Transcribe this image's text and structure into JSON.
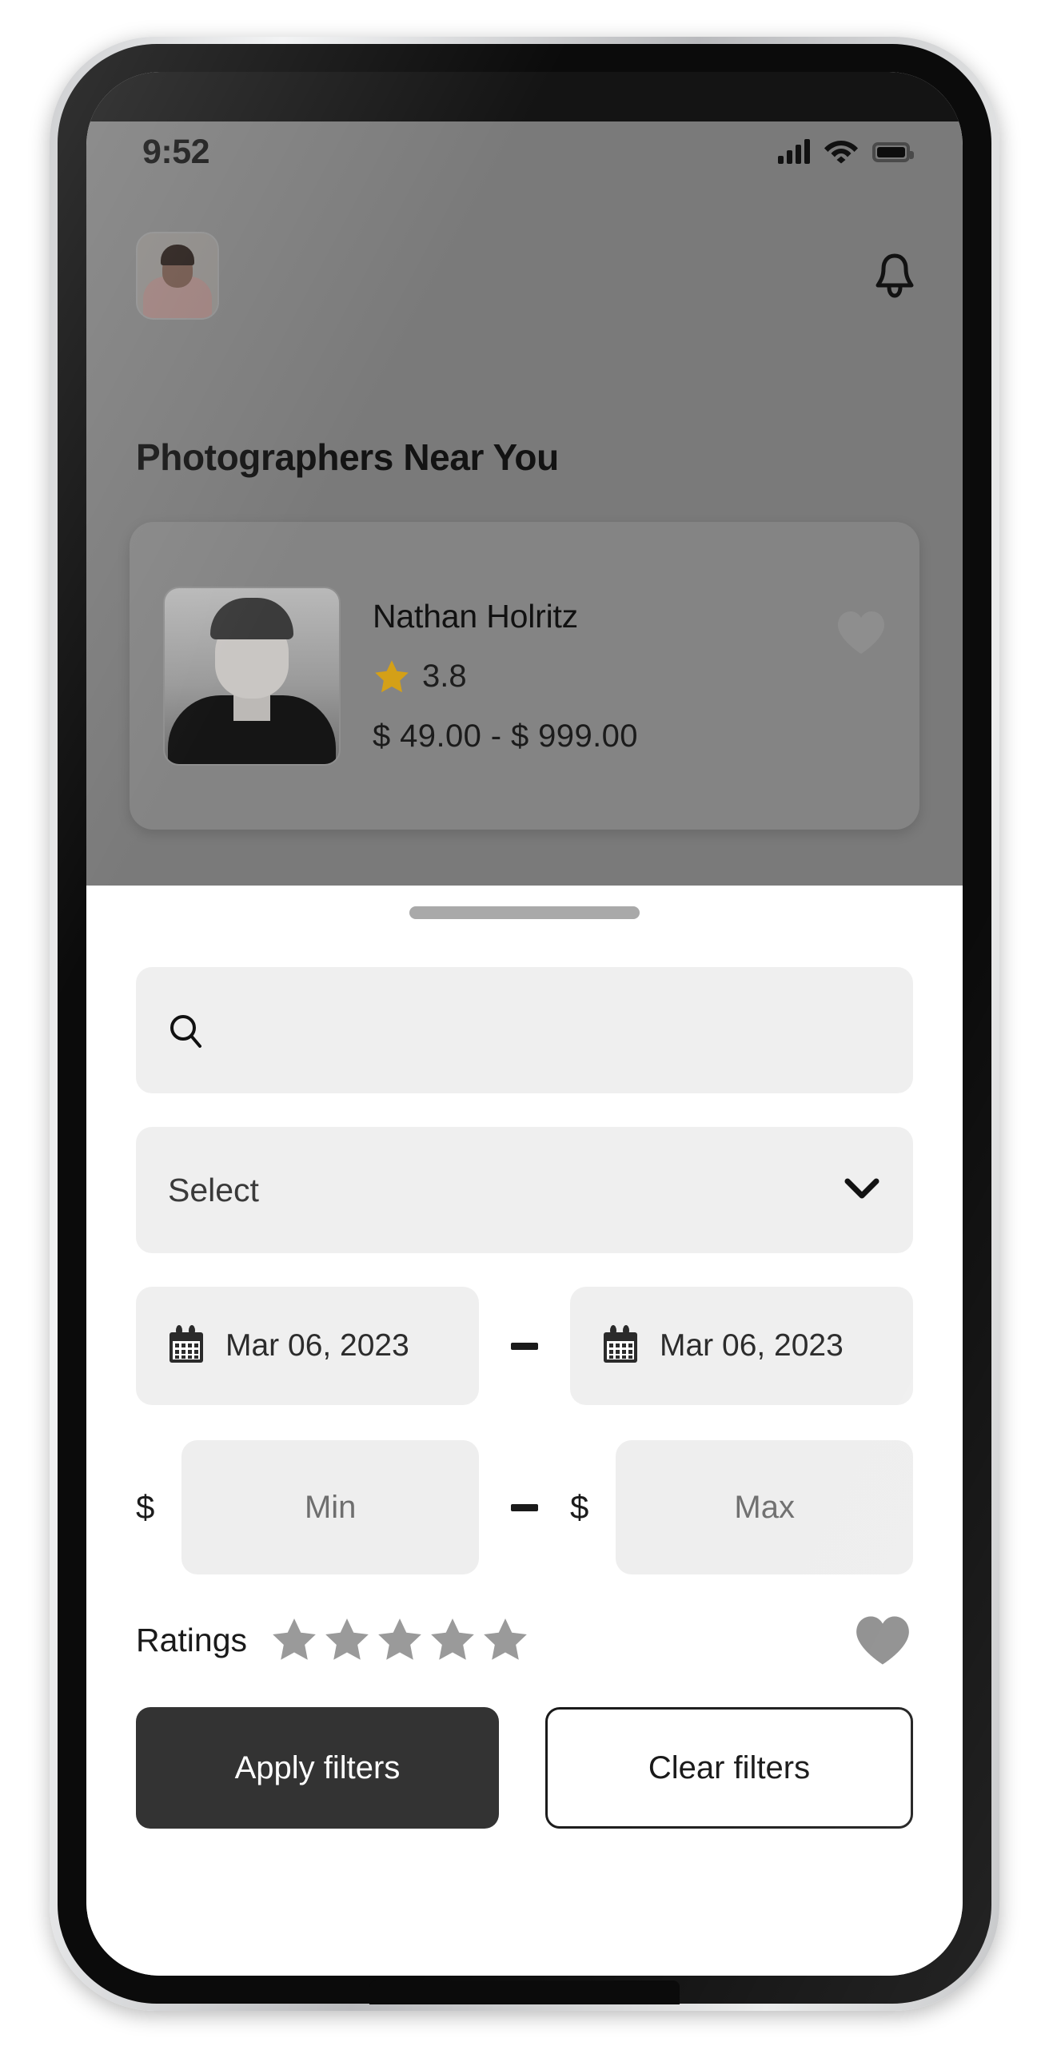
{
  "status_bar": {
    "time": "9:52",
    "icons": [
      "signal-bars-icon",
      "wifi-icon",
      "battery-icon"
    ]
  },
  "header": {
    "avatar_icon": "avatar",
    "notification_icon": "bell-icon"
  },
  "main": {
    "section_title": "Photographers Near You",
    "photographer_card": {
      "photo_icon": "photographer-photo",
      "name": "Nathan Holritz",
      "rating_icon": "star-icon",
      "rating": "3.8",
      "price_range": "$ 49.00  -  $ 999.00",
      "favorite_icon": "heart-icon"
    }
  },
  "filter_sheet": {
    "handle_icon": "drag-handle",
    "search": {
      "icon": "search-icon",
      "value": "",
      "placeholder": ""
    },
    "category_select": {
      "value": "Select",
      "chevron_icon": "chevron-down-icon"
    },
    "date_range": {
      "start": {
        "icon": "calendar-icon",
        "value": "Mar 06, 2023"
      },
      "separator": "-",
      "end": {
        "icon": "calendar-icon",
        "value": "Mar 06, 2023"
      }
    },
    "price_range": {
      "currency_symbol": "$",
      "min_placeholder": "Min",
      "min_value": "",
      "separator": "-",
      "max_placeholder": "Max",
      "max_value": ""
    },
    "ratings": {
      "label": "Ratings",
      "star_count": 5,
      "stars_filled": 0,
      "star_icon": "star-icon",
      "favorite_icon": "heart-icon"
    },
    "actions": {
      "apply_label": "Apply filters",
      "clear_label": "Clear filters"
    }
  },
  "colors": {
    "overlay_dim": "#7a7a7a",
    "sheet_bg": "#ffffff",
    "field_bg": "#efefef",
    "primary_button": "#333333",
    "star_gold": "#d4a017",
    "star_gray": "#9a9a9a",
    "heart_gray": "#8e8e8e",
    "text_dark": "#131313"
  }
}
